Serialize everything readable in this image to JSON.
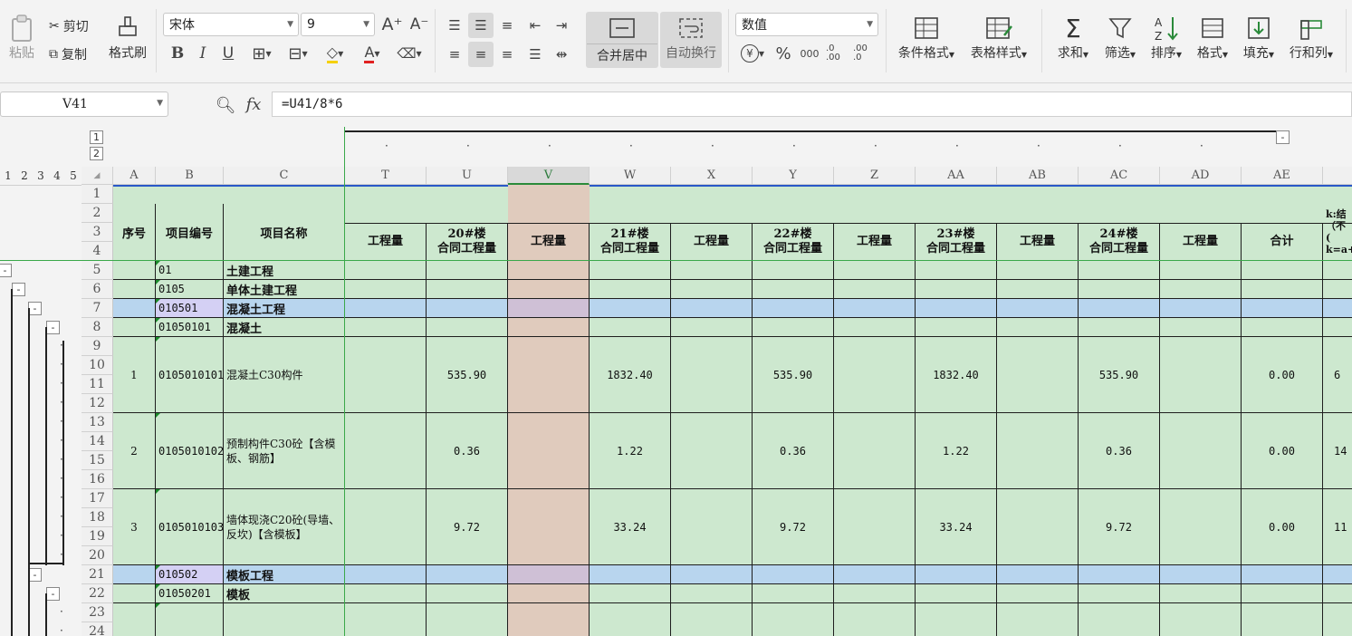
{
  "ribbon": {
    "paste": "粘贴",
    "cut": "剪切",
    "copy": "复制",
    "format_painter": "格式刷",
    "font_name": "宋体",
    "font_size": "9",
    "bold": "B",
    "italic": "I",
    "underline": "U",
    "merge_center": "合并居中",
    "auto_wrap": "自动换行",
    "number_format": "数值",
    "currency_symbol": "¥",
    "percent": "%",
    "thousands": "000",
    "inc_decimal": ".0 .00",
    "dec_decimal": ".00 .0",
    "conditional_format": "条件格式",
    "table_style": "表格样式",
    "sum": "求和",
    "filter": "筛选",
    "sort": "排序",
    "format": "格式",
    "fill": "填充",
    "row_col": "行和列"
  },
  "formula_bar": {
    "name_box": "V41",
    "fx": "fx",
    "formula": "=U41/8*6"
  },
  "outline": {
    "col_levels": [
      "1",
      "2"
    ],
    "row_levels": [
      "1",
      "2",
      "3",
      "4",
      "5"
    ],
    "collapse": "-",
    "dot": "·"
  },
  "columns": {
    "letters": [
      "A",
      "B",
      "C",
      "T",
      "U",
      "V",
      "W",
      "X",
      "Y",
      "Z",
      "AA",
      "AB",
      "AC",
      "AD",
      "AE"
    ]
  },
  "rows": {
    "numbers": [
      "1",
      "2",
      "3",
      "4",
      "5",
      "6",
      "7",
      "8",
      "9",
      "10",
      "11",
      "12",
      "13",
      "14",
      "15",
      "16",
      "17",
      "18",
      "19",
      "20",
      "21",
      "22",
      "23",
      "24"
    ]
  },
  "headers": {
    "seq": "序号",
    "item_code": "项目编号",
    "item_name": "项目名称",
    "qty": "工程量",
    "b20": "20#楼\n合同工程量",
    "b21": "21#楼\n合同工程量",
    "b22": "22#楼\n合同工程量",
    "b23": "23#楼\n合同工程量",
    "b24": "24#楼\n合同工程量",
    "total": "合计",
    "k_partial": "k:结\n（不\n(\nk=a+"
  },
  "table": {
    "r5": {
      "code": "01",
      "name": "土建工程"
    },
    "r6": {
      "code": "0105",
      "name": "单体土建工程"
    },
    "r7": {
      "code": "010501",
      "name": "混凝土工程"
    },
    "r8": {
      "code": "01050101",
      "name": "混凝土"
    },
    "r21": {
      "code": "010502",
      "name": "模板工程"
    },
    "r22": {
      "code": "01050201",
      "name": "模板"
    },
    "items": [
      {
        "seq": "1",
        "code": "0105010101",
        "name": "混凝土C30构件",
        "u": "535.90",
        "w": "1832.40",
        "y": "535.90",
        "aa": "1832.40",
        "ac": "535.90",
        "ae": "0.00",
        "af": "6"
      },
      {
        "seq": "2",
        "code": "0105010102",
        "name": "预制构件C30砼【含模板、钢筋】",
        "u": "0.36",
        "w": "1.22",
        "y": "0.36",
        "aa": "1.22",
        "ac": "0.36",
        "ae": "0.00",
        "af": "14"
      },
      {
        "seq": "3",
        "code": "0105010103",
        "name": "墙体现浇C20砼(导墙、反坎)【含模板】",
        "u": "9.72",
        "w": "33.24",
        "y": "9.72",
        "aa": "33.24",
        "ac": "9.72",
        "ae": "0.00",
        "af": "11"
      }
    ]
  },
  "colors": {
    "cell_green": "#cde8cf",
    "selected_col": "#e0cbbd",
    "row_blue": "#b8d5ee",
    "code_purple": "#d4d0f4"
  }
}
